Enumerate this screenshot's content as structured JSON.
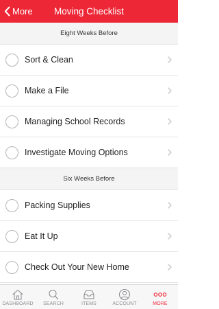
{
  "header": {
    "back_label": "More",
    "title": "Moving Checklist",
    "background_color": "#ee2737"
  },
  "sections": [
    {
      "title": "Eight Weeks Before",
      "items": [
        {
          "label": "Sort & Clean",
          "checked": false
        },
        {
          "label": "Make a File",
          "checked": false
        },
        {
          "label": "Managing School Records",
          "checked": false
        },
        {
          "label": "Investigate Moving Options",
          "checked": false
        }
      ]
    },
    {
      "title": "Six Weeks Before",
      "items": [
        {
          "label": "Packing Supplies",
          "checked": false
        },
        {
          "label": "Eat It Up",
          "checked": false
        },
        {
          "label": "Check Out Your New Home",
          "checked": false
        }
      ]
    }
  ],
  "tabbar": {
    "active_color": "#ee2737",
    "inactive_color": "#8e8e93",
    "tabs": [
      {
        "label": "DASHBOARD",
        "icon": "house-icon",
        "active": false
      },
      {
        "label": "SEARCH",
        "icon": "magnifier-icon",
        "active": false
      },
      {
        "label": "ITEMS",
        "icon": "inbox-tray-icon",
        "active": false
      },
      {
        "label": "ACCOUNT",
        "icon": "person-circle-icon",
        "active": false
      },
      {
        "label": "MORE",
        "icon": "three-dots-icon",
        "active": true
      }
    ]
  }
}
